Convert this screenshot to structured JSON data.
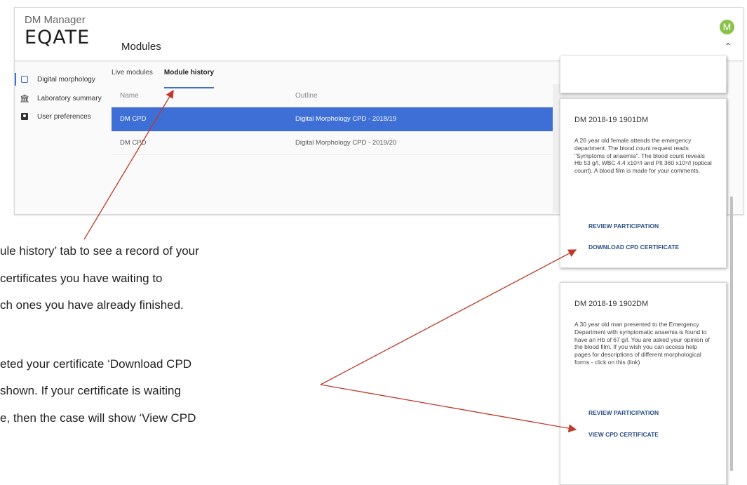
{
  "header": {
    "app_subtitle": "DM Manager",
    "brand": "EQATE",
    "page_title": "Modules",
    "avatar_letter": "M",
    "avatar_color": "#8bc34a"
  },
  "sidebar": {
    "items": [
      {
        "label": "Digital morphology",
        "icon": "calendar-icon"
      },
      {
        "label": "Laboratory summary",
        "icon": "bank-icon"
      },
      {
        "label": "User preferences",
        "icon": "user-card-icon"
      }
    ]
  },
  "tabs": [
    {
      "label": "Live modules"
    },
    {
      "label": "Module history"
    }
  ],
  "table": {
    "columns": [
      "Name",
      "Outline"
    ],
    "rows": [
      {
        "name": "DM CPD",
        "outline": "Digital Morphology CPD - 2018/19"
      },
      {
        "name": "DM CPD",
        "outline": "Digital Morphology CPD - 2019/20"
      }
    ]
  },
  "cards": [
    {
      "title": "DM 2018-19 1901DM",
      "body": "A 26 year old female attends the emergency department. The blood count request reads \"Symptoms of anaemia\". The blood count reveals Hb 53 g/l, WBC 4.4 x10⁹/l and Plt 360 x10⁹/l (optical count). A blood film is made for your comments.",
      "link1": "REVIEW PARTICIPATION",
      "link2": "DOWNLOAD CPD CERTIFICATE"
    },
    {
      "title": "DM 2018-19 1902DM",
      "body": "A 30 year old man presented to the Emergency Department with symptomatic anaemia is found to have an Hb of 67 g/l. You are asked your opinion of the blood film. If you wish you can access help pages for descriptions of different morphological forms - click on this (link)",
      "link1": "REVIEW PARTICIPATION",
      "link2": "VIEW CPD CERTIFICATE"
    }
  ],
  "captions": [
    "ule history’ tab to see a record of your",
    "certificates you have waiting to",
    "ch ones you have already finished.",
    "eted your certificate ‘Download CPD",
    "shown.  If your certificate is waiting",
    "e, then the case will show ‘View CPD"
  ],
  "colors": {
    "accent": "#3d6fd6",
    "arrow": "#c0392b",
    "link": "#2a4f87"
  }
}
